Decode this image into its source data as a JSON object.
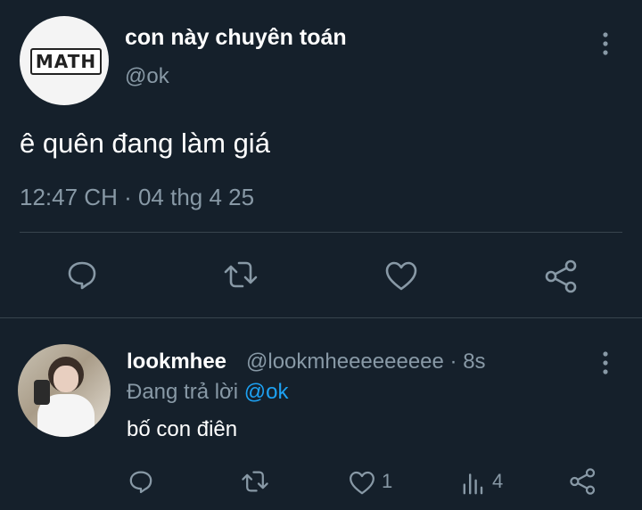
{
  "tweet": {
    "display_name": "con này chuyên toán",
    "handle": "@ok",
    "avatar_text": "MATH",
    "text": "ê quên đang làm giá",
    "timestamp": "12:47 CH · 04 thg 4 25"
  },
  "reply": {
    "display_name": "lookmhee",
    "handle_time": "@lookmheeeeeeeee · 8s",
    "replying_prefix": "Đang trả lời",
    "replying_to": "@ok",
    "text": "bố con điên",
    "like_count": "1",
    "view_count": "4"
  },
  "icons": {
    "reply": "reply-icon",
    "retweet": "retweet-icon",
    "like": "heart-icon",
    "share": "share-icon",
    "more": "more-vertical-icon",
    "views": "views-icon"
  },
  "colors": {
    "background": "#15202b",
    "secondary_text": "#8899a6",
    "mention": "#1da1f2",
    "divider": "#38444d"
  }
}
